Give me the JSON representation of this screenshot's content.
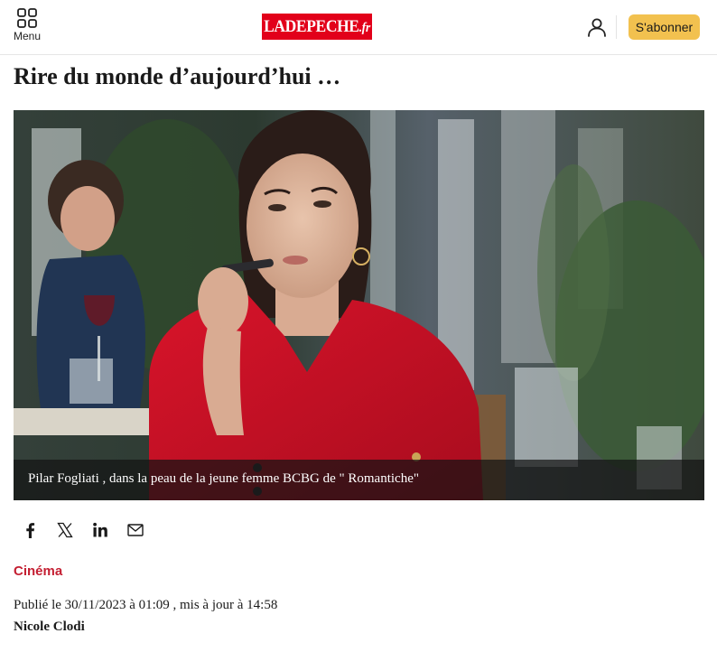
{
  "header": {
    "menu_label": "Menu",
    "logo_main": "LADEPECHE",
    "logo_suffix": ".fr",
    "subscribe_label": "S'abonner",
    "brand_color": "#e2001a",
    "subscribe_color": "#f2c14f",
    "icons": [
      "grid-menu-icon",
      "user-icon"
    ]
  },
  "article": {
    "title": "Rire du monde d’aujourd’hui …",
    "image_caption": "Pilar Fogliati , dans la peau de la jeune femme BCBG de \" Romantiche\"",
    "category": "Cinéma",
    "category_color": "#c41f32",
    "published": "Publié le 30/11/2023 à 01:09 , mis à jour à 14:58",
    "author": "Nicole Clodi"
  },
  "share": {
    "icons": [
      "facebook-icon",
      "x-icon",
      "linkedin-icon",
      "email-icon"
    ]
  }
}
